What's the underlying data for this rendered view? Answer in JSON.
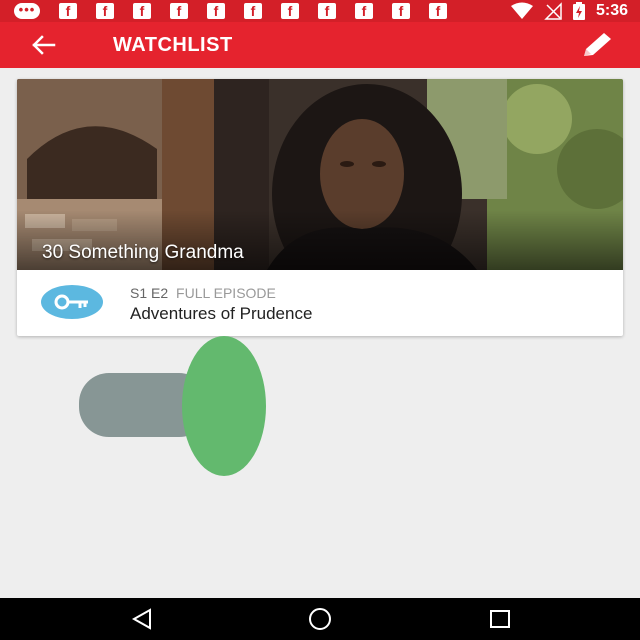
{
  "status_bar": {
    "time": "5:36",
    "notification_icons": [
      "chat-icon",
      "facebook-icon",
      "facebook-icon",
      "facebook-icon",
      "facebook-icon",
      "facebook-icon",
      "facebook-icon",
      "facebook-icon",
      "facebook-icon",
      "facebook-icon",
      "facebook-icon",
      "facebook-icon"
    ],
    "chat_glyph": "•••",
    "fb_glyph": "f",
    "system_icons": [
      "wifi-icon",
      "no-signal-icon",
      "battery-charging-icon"
    ]
  },
  "app_bar": {
    "title": "WATCHLIST",
    "back_icon": "arrow-back-icon",
    "edit_icon": "pencil-icon",
    "color": "#e5232e"
  },
  "watchlist": {
    "items": [
      {
        "show_title": "30 Something Grandma",
        "episode_code": "S1 E2",
        "episode_type": "FULL EPISODE",
        "episode_title": "Adventures of Prudence",
        "badge_icon": "key-icon",
        "badge_color": "#5cb8e0"
      }
    ]
  },
  "nav_bar": {
    "buttons": [
      "back-triangle-icon",
      "home-circle-icon",
      "recents-square-icon"
    ]
  }
}
